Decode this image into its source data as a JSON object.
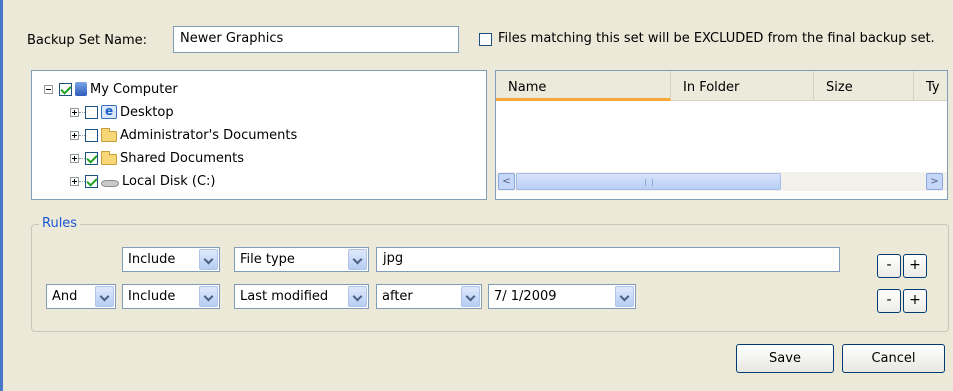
{
  "header": {
    "backup_set_label": "Backup Set Name:",
    "backup_set_value": "Newer Graphics",
    "exclude_checkbox_checked": false,
    "exclude_label": "Files matching this set will be EXCLUDED from the final backup set."
  },
  "tree": {
    "root": {
      "label": "My Computer",
      "checked": true,
      "icon": "computer-icon"
    },
    "items": [
      {
        "label": "Desktop",
        "checked": false,
        "icon": "desktop-icon"
      },
      {
        "label": "Administrator's Documents",
        "checked": false,
        "icon": "folder-icon"
      },
      {
        "label": "Shared Documents",
        "checked": true,
        "icon": "folder-icon"
      },
      {
        "label": "Local Disk (C:)",
        "checked": true,
        "icon": "disk-icon"
      }
    ]
  },
  "listview": {
    "columns": [
      "Name",
      "In Folder",
      "Size",
      "Ty"
    ],
    "scroll_left": "<",
    "scroll_right": ">"
  },
  "rules": {
    "legend": "Rules",
    "rows": [
      {
        "conjunction": "",
        "mode": "Include",
        "field": "File type",
        "operator": "",
        "value": "jpg"
      },
      {
        "conjunction": "And",
        "mode": "Include",
        "field": "Last modified",
        "operator": "after",
        "value": "7/ 1/2009"
      }
    ],
    "remove_label": "-",
    "add_label": "+"
  },
  "footer": {
    "save_label": "Save",
    "cancel_label": "Cancel"
  }
}
